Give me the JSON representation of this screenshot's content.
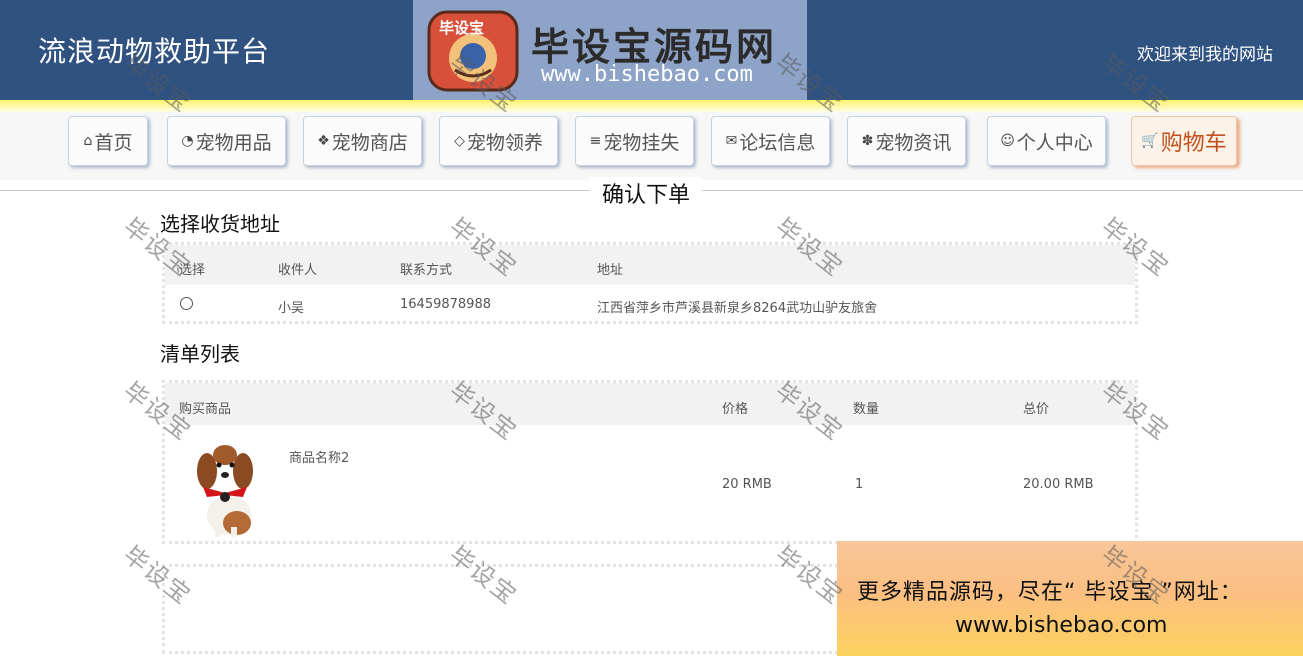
{
  "header": {
    "site_title": "流浪动物救助平台",
    "welcome": "欢迎来到我的网站",
    "logo": {
      "badge": "毕设宝",
      "name": "毕设宝源码网",
      "url": "www.bishebao.com"
    }
  },
  "nav": {
    "items": [
      {
        "icon": "⌂",
        "label": "首页"
      },
      {
        "icon": "◔",
        "label": "宠物用品"
      },
      {
        "icon": "❖",
        "label": "宠物商店"
      },
      {
        "icon": "◇",
        "label": "宠物领养"
      },
      {
        "icon": "≡",
        "label": "宠物挂失"
      },
      {
        "icon": "✉",
        "label": "论坛信息"
      },
      {
        "icon": "✽",
        "label": "宠物资讯"
      },
      {
        "icon": "☺",
        "label": "个人中心"
      },
      {
        "icon": "🛒",
        "label": "购物车"
      }
    ]
  },
  "page_title": "确认下单",
  "address": {
    "title": "选择收货地址",
    "headers": [
      "选择",
      "收件人",
      "联系方式",
      "地址"
    ],
    "rows": [
      {
        "name": "小吴",
        "phone": "16459878988",
        "address": "江西省萍乡市芦溪县新泉乡8264武功山驴友旅舍"
      }
    ]
  },
  "order": {
    "title": "清单列表",
    "headers": [
      "购买商品",
      "价格",
      "数量",
      "总价"
    ],
    "rows": [
      {
        "product": "商品名称2",
        "price": "20 RMB",
        "qty": "1",
        "total": "20.00 RMB"
      }
    ]
  },
  "promo": {
    "line1": "更多精品源码，尽在“ 毕设宝 ”网址：",
    "line2": "www.bishebao.com"
  },
  "watermark": "毕设宝",
  "colors": {
    "header_bg": "#2f5281",
    "accent_cart": "#c2501c"
  }
}
